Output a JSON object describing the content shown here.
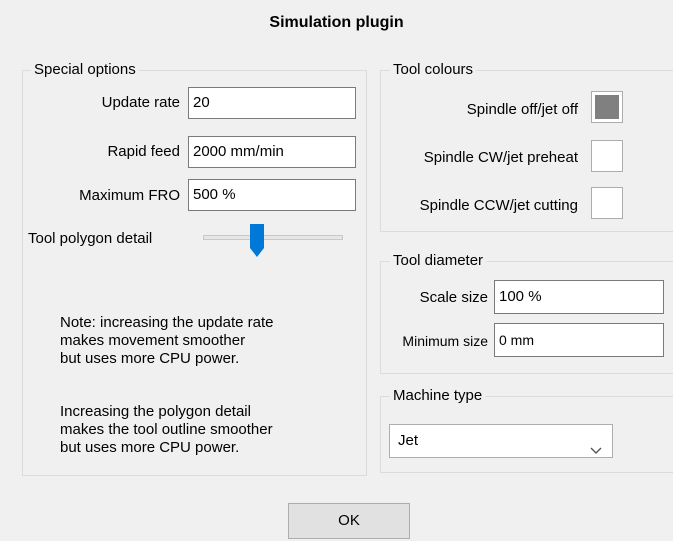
{
  "dialog": {
    "title": "Simulation plugin",
    "ok_label": "OK"
  },
  "special_options": {
    "legend": "Special options",
    "update_rate": {
      "label": "Update rate",
      "value": "20"
    },
    "rapid_feed": {
      "label": "Rapid feed",
      "value": "2000 mm/min"
    },
    "max_fro": {
      "label": "Maximum FRO",
      "value": "500 %"
    },
    "polygon_detail": {
      "label": "Tool polygon detail",
      "level": 0.37
    },
    "note1": [
      "Note: increasing the update rate",
      "makes movement smoother",
      "but uses more CPU power."
    ],
    "note2": [
      "Increasing the polygon detail",
      "makes the tool outline smoother",
      "but uses more CPU power."
    ]
  },
  "tool_colours": {
    "legend": "Tool colours",
    "items": [
      {
        "label": "Spindle off/jet off",
        "color": "#808080"
      },
      {
        "label": "Spindle CW/jet preheat",
        "color": "#ffffff"
      },
      {
        "label": "Spindle CCW/jet cutting",
        "color": "#ffffff"
      }
    ]
  },
  "tool_diameter": {
    "legend": "Tool diameter",
    "scale_size": {
      "label": "Scale size",
      "value": "100 %"
    },
    "min_size": {
      "label": "Minimum size",
      "value": "0 mm"
    }
  },
  "machine_type": {
    "legend": "Machine type",
    "selected": "Jet"
  },
  "colors": {
    "slider_thumb": "#0078d7",
    "background": "#f0f0f0"
  }
}
